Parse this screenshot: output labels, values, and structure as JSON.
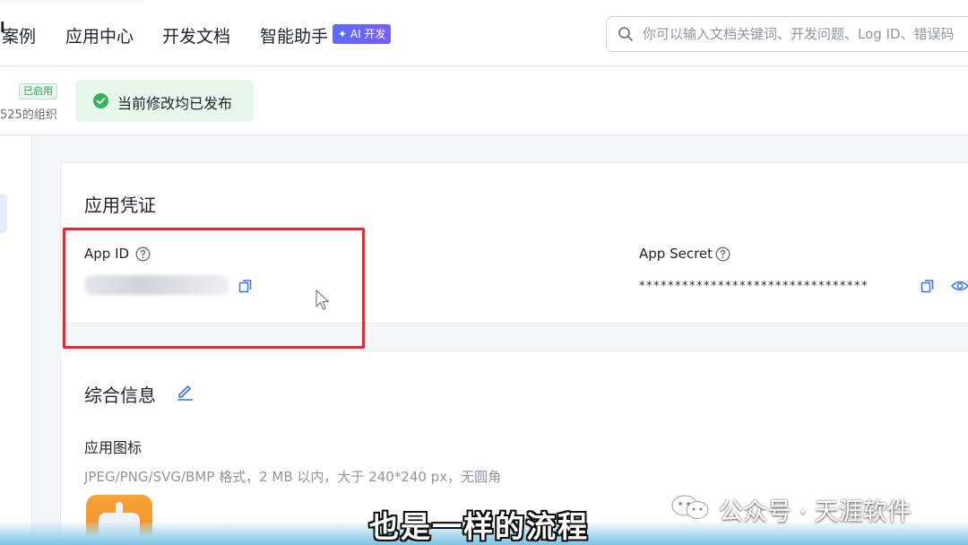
{
  "nav": {
    "items": [
      "案例",
      "应用中心",
      "开发文档",
      "智能助手"
    ],
    "ai_badge": "✦ AI 开发",
    "search_placeholder": "你可以输入文档关键词、开发问题、Log ID、错误码"
  },
  "app_header": {
    "name_mark": "l",
    "status_badge": "已启用",
    "org_text": "525的组织",
    "publish_status": "当前修改均已发布"
  },
  "credentials": {
    "title": "应用凭证",
    "app_id_label": "App ID",
    "app_secret_label": "App Secret",
    "app_secret_masked": "********************************"
  },
  "info": {
    "title": "综合信息",
    "icon_label": "应用图标",
    "icon_hint": "JPEG/PNG/SVG/BMP 格式，2 MB 以内，大于 240*240 px，无圆角"
  },
  "overlay": {
    "watermark": "公众号 · 天涯软件",
    "subtitle": "也是一样的流程"
  },
  "colors": {
    "accent": "#3370ff",
    "success": "#2ea05a",
    "highlight_box": "#e12b36",
    "app_icon": "#f59a2a"
  }
}
